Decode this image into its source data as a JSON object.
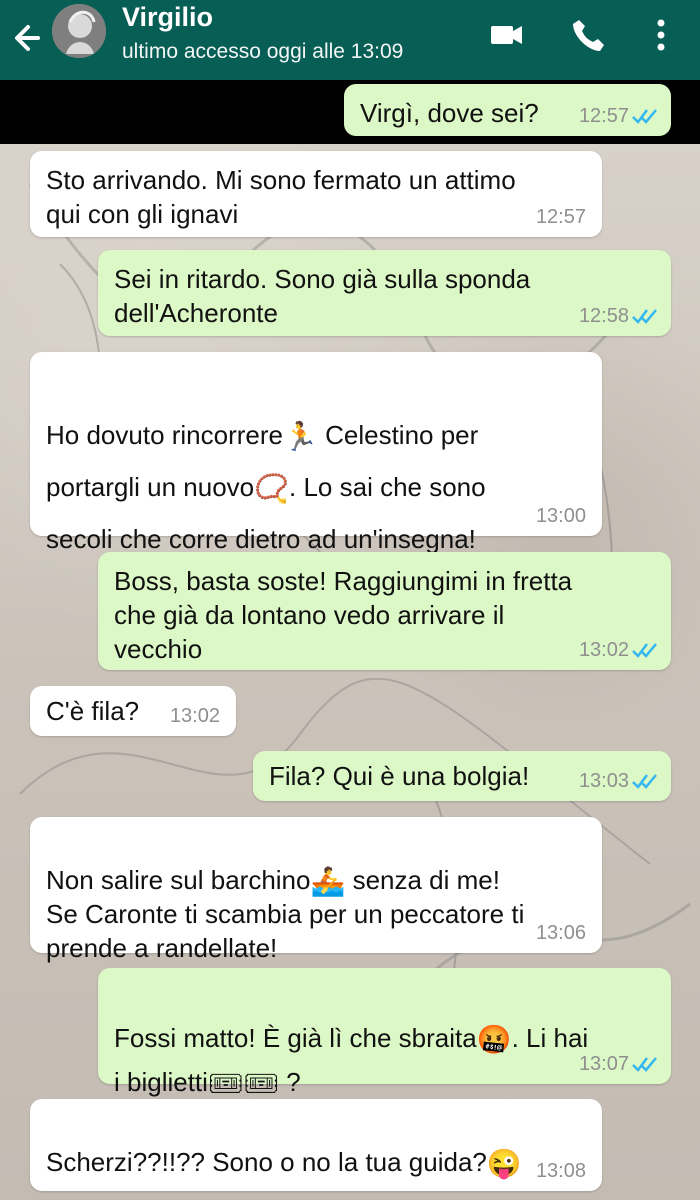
{
  "header": {
    "contact_name": "Virgilio",
    "status": "ultimo accesso oggi alle 13:09"
  },
  "icons": {
    "back": "arrow-left",
    "video": "video-camera",
    "call": "phone",
    "menu": "vertical-dots"
  },
  "messages": [
    {
      "from": "me",
      "text": "Virgì, dove sei?",
      "time": "12:57"
    },
    {
      "from": "contact",
      "text": "Sto arrivando. Mi sono fermato un attimo\nqui con gli ignavi",
      "time": "12:57"
    },
    {
      "from": "me",
      "text": "Sei in ritardo. Sono già sulla sponda\ndell'Acheronte",
      "time": "12:58"
    },
    {
      "from": "contact",
      "text_parts": [
        "Ho dovuto rincorrere",
        "🏃",
        "Celestino per\nportargli un nuovo",
        "📿",
        ". Lo sai che sono\nsecoli che corre dietro ad un'insegna!"
      ],
      "time": "13:00"
    },
    {
      "from": "me",
      "text": "Boss, basta soste! Raggiungimi in fretta\nche già da lontano vedo arrivare il\nvecchio",
      "time": "13:02"
    },
    {
      "from": "contact",
      "text": "C'è fila?",
      "time": "13:02"
    },
    {
      "from": "me",
      "text": "Fila? Qui è una bolgia!",
      "time": "13:03"
    },
    {
      "from": "contact",
      "text_parts": [
        "Non salire sul barchino",
        "🚣",
        "senza di me!\nSe Caronte ti scambia per un peccatore ti\nprende a randellate!"
      ],
      "time": "13:06"
    },
    {
      "from": "me",
      "text_parts": [
        "Fossi matto! È già lì che sbraita",
        "🤬",
        ". Li hai\ni biglietti",
        "🎟",
        "🎟",
        " ?"
      ],
      "time": "13:07"
    },
    {
      "from": "contact",
      "text_parts": [
        "Scherzi??!!?? Sono o no la tua guida?",
        "😜"
      ],
      "time": "13:08"
    }
  ],
  "colors": {
    "header": "#075e54",
    "incoming": "#ffffff",
    "outgoing": "#dcf8c6",
    "read_ticks": "#34b7f1"
  }
}
